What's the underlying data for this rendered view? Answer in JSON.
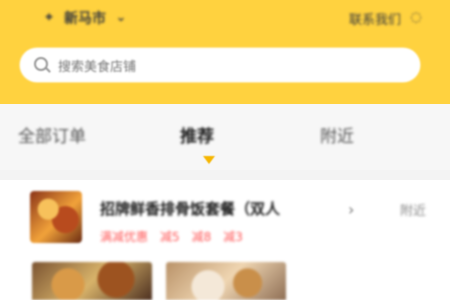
{
  "header": {
    "location": "新马市",
    "right_text": "联系我们",
    "accent": "#ffd23f"
  },
  "search": {
    "placeholder": "搜索美食店铺"
  },
  "tabs": [
    {
      "label": "全部订单"
    },
    {
      "label": "推荐"
    },
    {
      "label": "附近"
    }
  ],
  "card": {
    "title": "招牌鲜香排骨饭套餐（双人",
    "right_note": "附近",
    "tags": [
      "满减优惠",
      "减5",
      "减8",
      "减3"
    ]
  }
}
